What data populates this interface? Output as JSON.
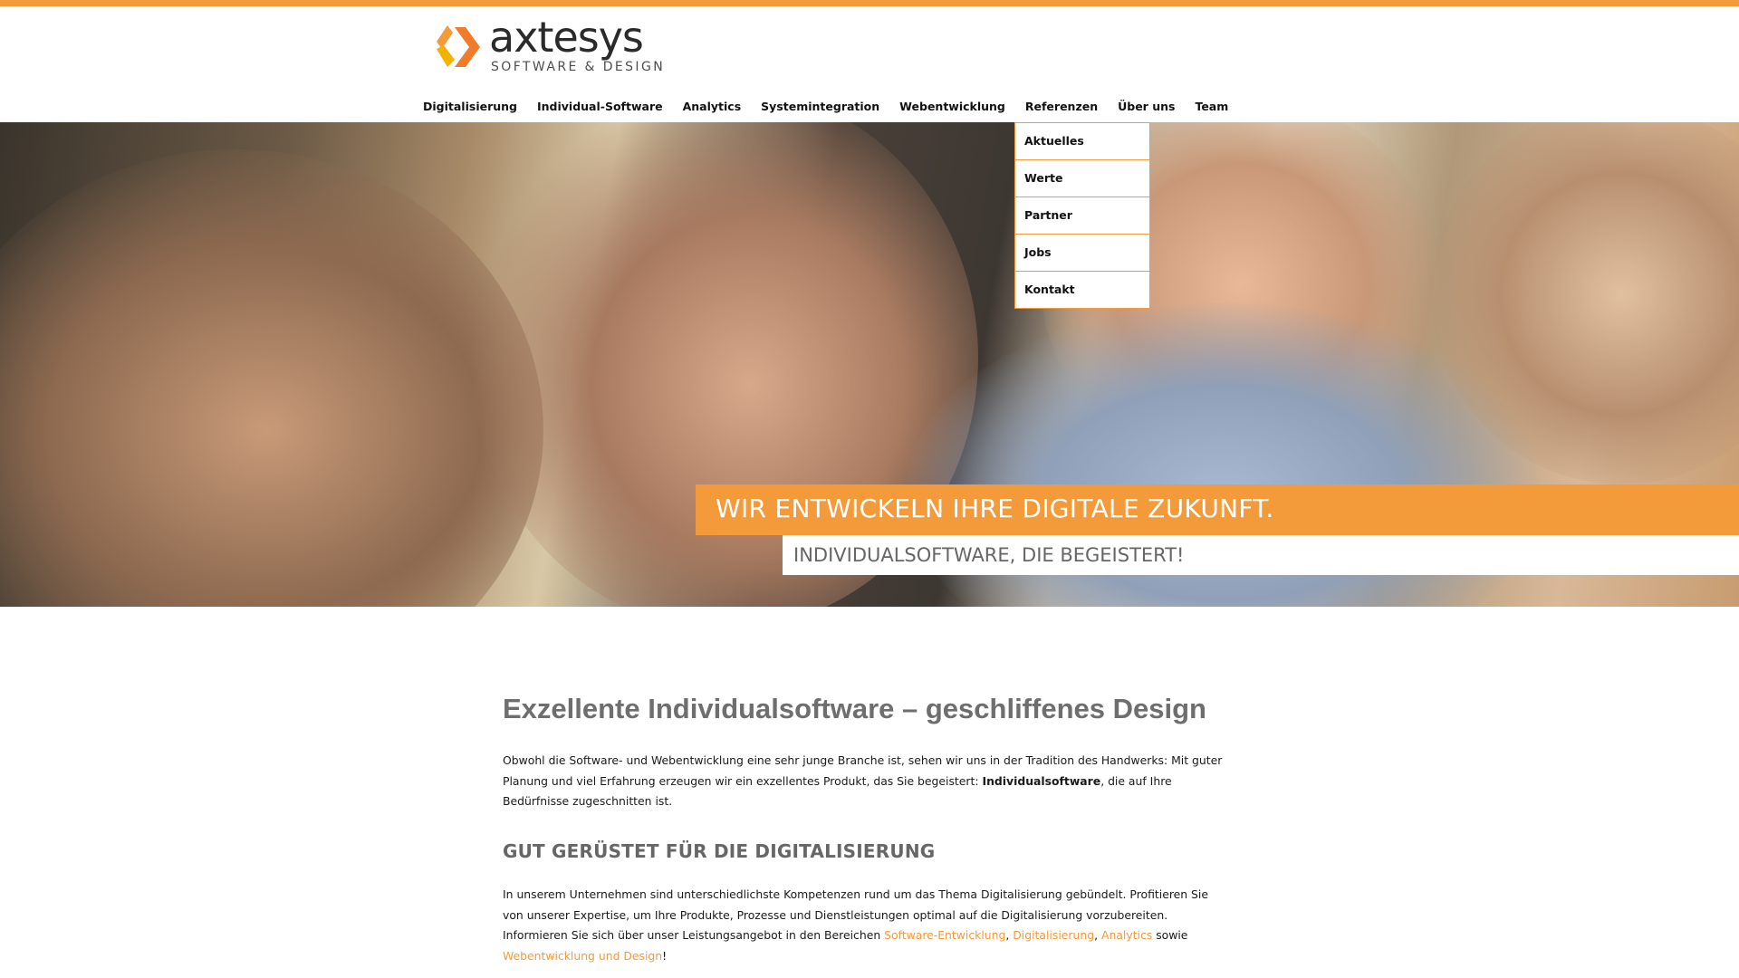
{
  "header": {
    "logo_name": "axtesys",
    "logo_tagline": "SOFTWARE & DESIGN"
  },
  "nav": {
    "items": [
      "Digitalisierung",
      "Individual-Software",
      "Analytics",
      "Systemintegration",
      "Webentwicklung",
      "Referenzen",
      "Über uns",
      "Team"
    ],
    "dropdown": [
      "Aktuelles",
      "Werte",
      "Partner",
      "Jobs",
      "Kontakt"
    ]
  },
  "hero": {
    "headline": "WIR ENTWICKELN IHRE DIGITALE ZUKUNFT.",
    "subline": "INDIVIDUALSOFTWARE, DIE BEGEISTERT!"
  },
  "main": {
    "title": "Exzellente Individualsoftware – geschliffenes Design",
    "intro_part1": "Obwohl die Software- und Webentwicklung eine sehr junge Branche ist, sehen wir uns in der Tradition des Handwerks: Mit guter Planung und viel Erfahrung erzeugen wir ein exzellentes Produkt, das Sie begeistert: ",
    "intro_bold": "Individualsoftware",
    "intro_part2": ", die auf Ihre Bedürfnisse zugeschnitten ist.",
    "section_title": "GUT GERÜSTET FÜR DIE DIGITALISIERUNG",
    "section_text_part1": "In unserem Unternehmen sind unterschiedlichste Kompetenzen rund um das Thema Digitalisierung gebündelt. Profitieren Sie von unserer Expertise, um Ihre Produkte, Prozesse und Dienstleistungen optimal auf die Digitalisierung vorzubereiten. Informieren Sie sich über unser Leistungsangebot in den Bereichen ",
    "link_software": "Software-Entwicklung",
    "sep1": ", ",
    "link_digital": "Digitalisierung",
    "sep2": ", ",
    "link_analytics": "Analytics",
    "sep3": " sowie ",
    "link_web": "Webentwicklung und Design",
    "end": "!"
  },
  "colors": {
    "accent": "#f39a3b",
    "heading_gray": "#6e6e6e"
  }
}
